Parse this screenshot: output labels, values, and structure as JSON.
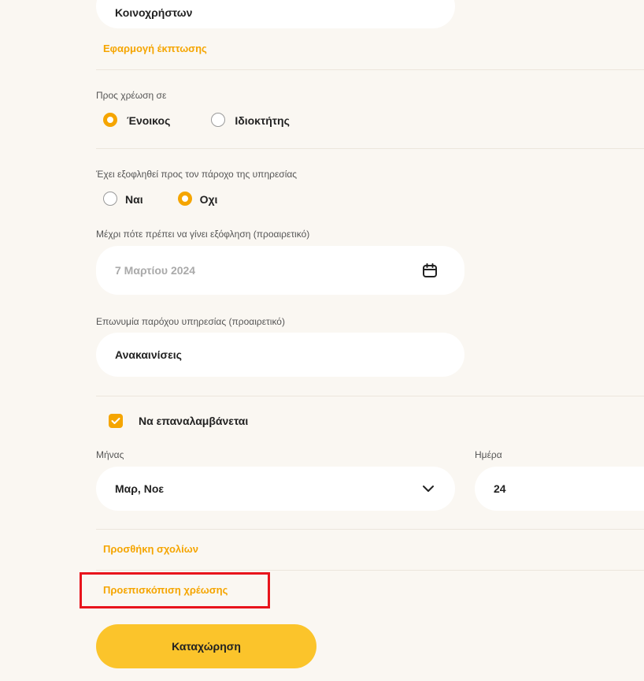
{
  "category_select": {
    "value": "Κοινοχρήστων"
  },
  "apply_discount_link": "Εφαρμογή έκπτωσης",
  "charge_to": {
    "label": "Προς χρέωση σε",
    "options": [
      "Ένοικος",
      "Ιδιοκτήτης"
    ],
    "selected": "Ένοικος"
  },
  "paid_to_provider": {
    "label": "Έχει εξοφληθεί προς τον πάροχο της υπηρεσίας",
    "options": [
      "Ναι",
      "Οχι"
    ],
    "selected": "Οχι"
  },
  "due_date": {
    "label": "Μέχρι πότε πρέπει να γίνει εξόφληση (προαιρετικό)",
    "value": "7 Μαρτίου 2024"
  },
  "provider_name": {
    "label": "Επωνυμία παρόχου υπηρεσίας (προαιρετικό)",
    "value": "Ανακαινίσεις"
  },
  "recurring": {
    "label": "Να επαναλαμβάνεται",
    "checked": true
  },
  "month": {
    "label": "Μήνας",
    "value": "Μαρ, Νοε"
  },
  "day": {
    "label": "Ημέρα",
    "value": "24"
  },
  "add_comments_link": "Προσθήκη σχολίων",
  "preview_charge_link": "Προεπισκόπιση χρέωσης",
  "submit_button": "Καταχώρηση",
  "colors": {
    "accent": "#f5a500",
    "button": "#fbc42b",
    "highlight": "#e8141c",
    "background": "#faf7f2"
  }
}
